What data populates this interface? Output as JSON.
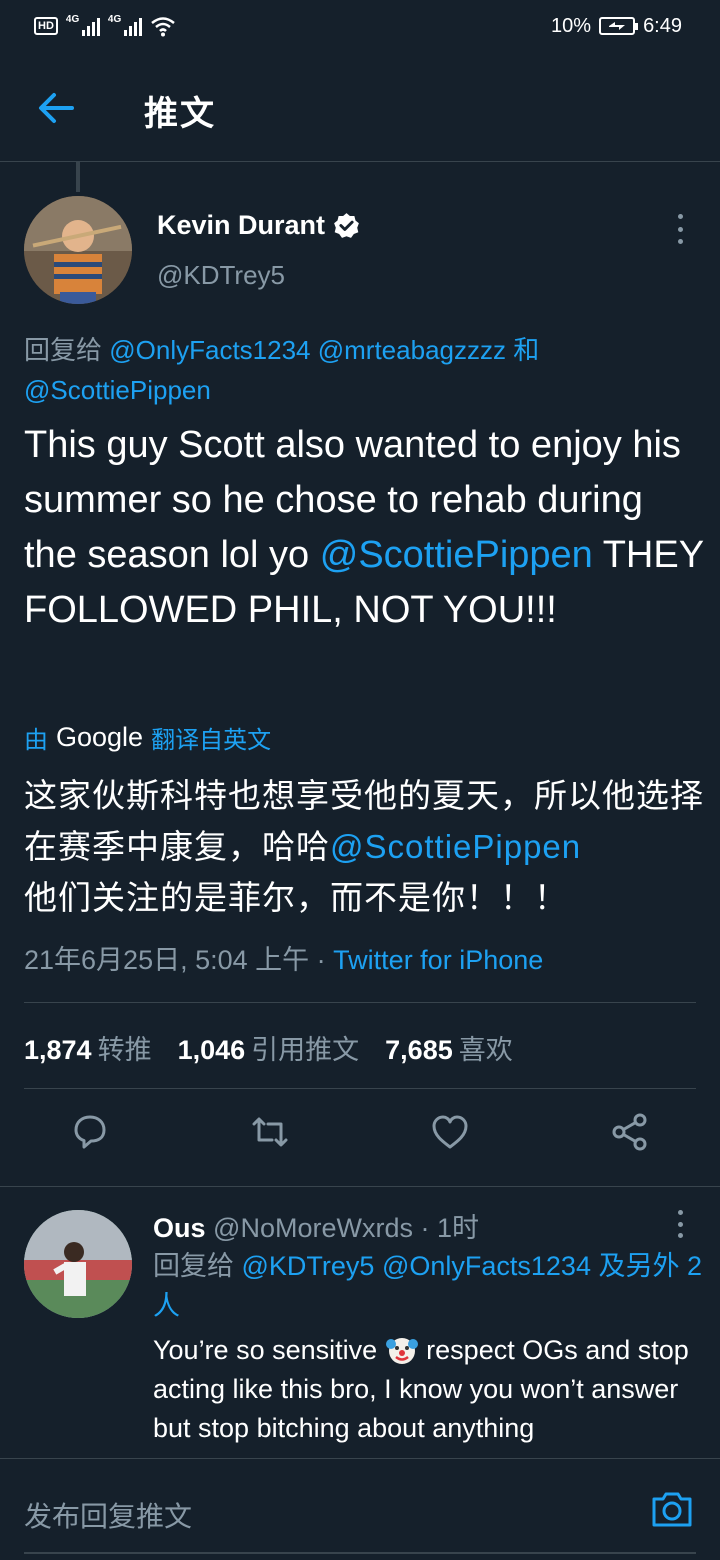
{
  "status_bar": {
    "hd": "HD",
    "network_1": "4G",
    "network_2": "4G",
    "battery_percent": "10%",
    "time": "6:49",
    "battery_level": 0.1
  },
  "header": {
    "title": "推文"
  },
  "tweet": {
    "author_name": "Kevin Durant",
    "author_handle": "@KDTrey5",
    "reply_prefix": "回复给",
    "reply_mention_1": "@OnlyFacts1234",
    "reply_mention_2": "@mrteabagzzzz",
    "reply_and": "和",
    "reply_mention_3": "@ScottiePippen",
    "text_part_1": "This guy Scott also wanted to enjoy his summer so he chose to rehab during the season lol yo",
    "text_mention": "@ScottiePippen",
    "text_part_2": "THEY FOLLOWED PHIL, NOT YOU!!!",
    "translate_prefix": "由",
    "translate_brand": "Google",
    "translate_suffix": "翻译自英文",
    "translated_part_1": "这家伙斯科特也想享受他的夏天，所以他选择在赛季中康复，哈哈",
    "translated_mention": "@ScottiePippen",
    "translated_part_2": "他们关注的是菲尔，而不是你！！！",
    "timestamp": "21年6月25日, 5:04 上午",
    "meta_separator": "·",
    "source": "Twitter for iPhone"
  },
  "stats": {
    "retweets_count": "1,874",
    "retweets_label": "转推",
    "quotes_count": "1,046",
    "quotes_label": "引用推文",
    "likes_count": "7,685",
    "likes_label": "喜欢"
  },
  "actions": {
    "reply_icon": "comment-icon",
    "retweet_icon": "retweet-icon",
    "like_icon": "heart-icon",
    "share_icon": "share-icon"
  },
  "reply": {
    "name": "Ous",
    "handle": "@NoMoreWxrds",
    "separator": "·",
    "time": "1时",
    "reply_prefix": "回复给",
    "reply_mention_1": "@KDTrey5",
    "reply_mention_2": "@OnlyFacts1234",
    "reply_others": "及另外 2 人",
    "text_part_1": "You’re so sensitive",
    "text_part_2": "respect OGs and stop acting like this bro, I know you won’t answer but stop bitching about anything"
  },
  "compose": {
    "placeholder": "发布回复推文"
  },
  "colors": {
    "background": "#15202b",
    "accent": "#1da1f2",
    "secondary_text": "#8899a6",
    "divider": "#38444d"
  }
}
